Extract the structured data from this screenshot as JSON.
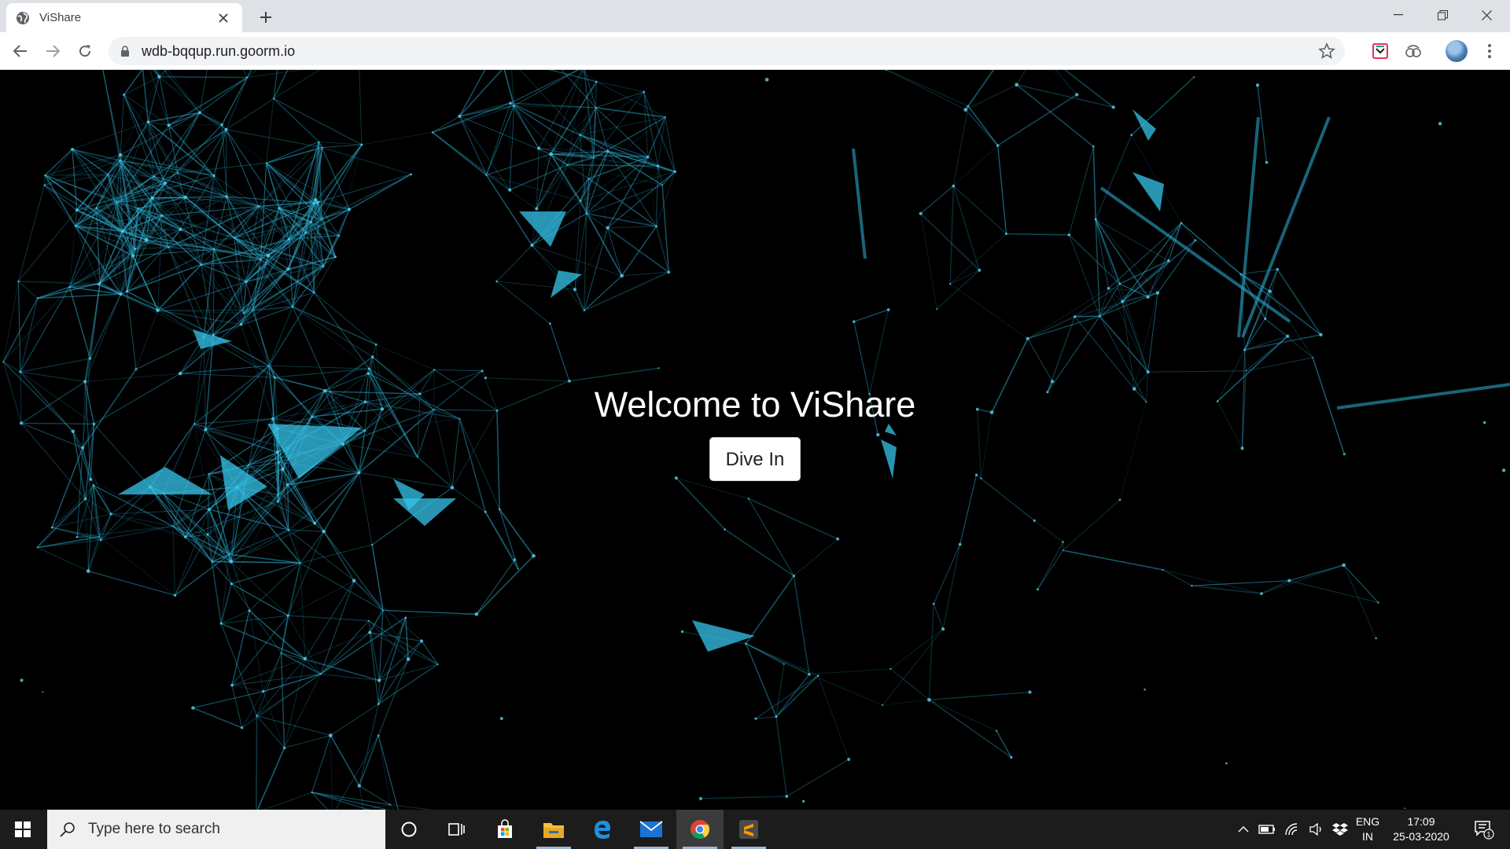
{
  "browser": {
    "tab_title": "ViShare",
    "url": "wdb-bqqup.run.goorm.io"
  },
  "page": {
    "heading": "Welcome to ViShare",
    "cta_label": "Dive In"
  },
  "taskbar": {
    "search_placeholder": "Type here to search",
    "lang_line1": "ENG",
    "lang_line2": "IN",
    "time": "17:09",
    "date": "25-03-2020",
    "notification_count": "1",
    "apps": [
      "task-view",
      "microsoft-store",
      "file-explorer",
      "edge",
      "mail",
      "chrome",
      "sublime-text"
    ]
  },
  "colors": {
    "network_line": "#2aa7c9",
    "background": "#000000",
    "accent_triangle": "#35c6ec"
  }
}
